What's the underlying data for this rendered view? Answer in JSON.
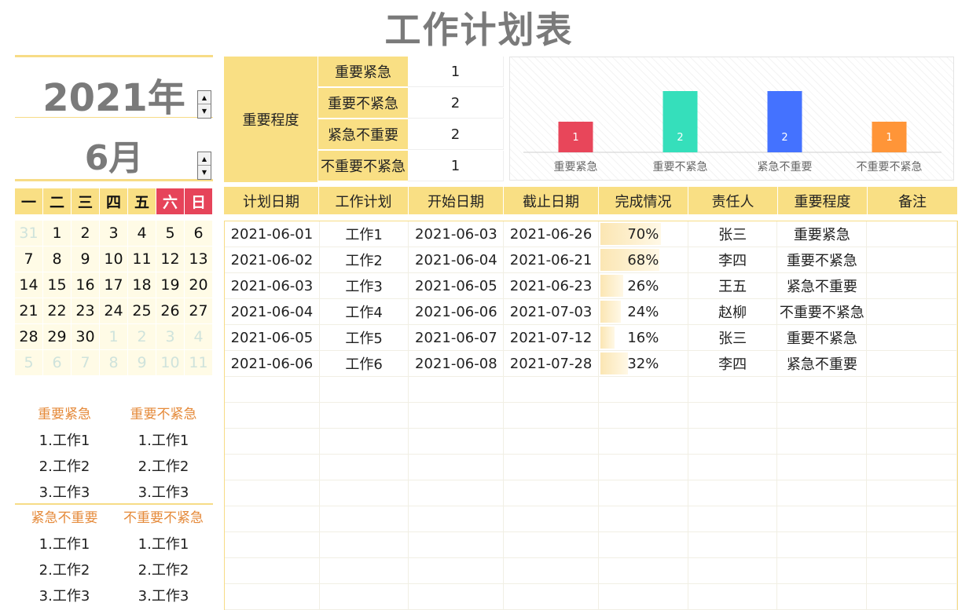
{
  "title": "工作计划表",
  "year": "2021年",
  "month": "6月",
  "calendar": {
    "weekdays": [
      "一",
      "二",
      "三",
      "四",
      "五",
      "六",
      "日"
    ],
    "weeks": [
      [
        {
          "d": "31",
          "dim": true
        },
        {
          "d": "1"
        },
        {
          "d": "2"
        },
        {
          "d": "3"
        },
        {
          "d": "4"
        },
        {
          "d": "5"
        },
        {
          "d": "6"
        }
      ],
      [
        {
          "d": "7"
        },
        {
          "d": "8"
        },
        {
          "d": "9"
        },
        {
          "d": "10"
        },
        {
          "d": "11"
        },
        {
          "d": "12"
        },
        {
          "d": "13"
        }
      ],
      [
        {
          "d": "14"
        },
        {
          "d": "15"
        },
        {
          "d": "16"
        },
        {
          "d": "17"
        },
        {
          "d": "18"
        },
        {
          "d": "19"
        },
        {
          "d": "20"
        }
      ],
      [
        {
          "d": "21"
        },
        {
          "d": "22"
        },
        {
          "d": "23"
        },
        {
          "d": "24"
        },
        {
          "d": "25"
        },
        {
          "d": "26"
        },
        {
          "d": "27"
        }
      ],
      [
        {
          "d": "28"
        },
        {
          "d": "29"
        },
        {
          "d": "30"
        },
        {
          "d": "1",
          "dim": true
        },
        {
          "d": "2",
          "dim": true
        },
        {
          "d": "3",
          "dim": true
        },
        {
          "d": "4",
          "dim": true
        }
      ],
      [
        {
          "d": "5",
          "dim": true
        },
        {
          "d": "6",
          "dim": true
        },
        {
          "d": "7",
          "dim": true
        },
        {
          "d": "8",
          "dim": true
        },
        {
          "d": "9",
          "dim": true
        },
        {
          "d": "10",
          "dim": true
        },
        {
          "d": "11",
          "dim": true
        }
      ]
    ]
  },
  "quadrants_top": {
    "left": {
      "title": "重要紧急",
      "items": [
        "1.工作1",
        "2.工作2",
        "3.工作3"
      ]
    },
    "right": {
      "title": "重要不紧急",
      "items": [
        "1.工作1",
        "2.工作2",
        "3.工作3"
      ]
    }
  },
  "quadrants_bottom": {
    "left": {
      "title": "紧急不重要",
      "items": [
        "1.工作1",
        "2.工作2",
        "3.工作3"
      ]
    },
    "right": {
      "title": "不重要不紧急",
      "items": [
        "1.工作1",
        "2.工作2",
        "3.工作3"
      ]
    }
  },
  "importance": {
    "label": "重要程度",
    "rows": [
      {
        "name": "重要紧急",
        "count": "1"
      },
      {
        "name": "重要不紧急",
        "count": "2"
      },
      {
        "name": "紧急不重要",
        "count": "2"
      },
      {
        "name": "不重要不紧急",
        "count": "1"
      }
    ]
  },
  "chart_data": {
    "type": "bar",
    "categories": [
      "重要紧急",
      "重要不紧急",
      "紧急不重要",
      "不重要不紧急"
    ],
    "values": [
      1,
      2,
      2,
      1
    ],
    "colors": [
      "#e8465a",
      "#35dfbb",
      "#4472ff",
      "#ff9538"
    ],
    "ylim": [
      0,
      2
    ],
    "grid": false,
    "data_labels": true
  },
  "table": {
    "headers": [
      "计划日期",
      "工作计划",
      "开始日期",
      "截止日期",
      "完成情况",
      "责任人",
      "重要程度",
      "备注"
    ],
    "rows": [
      {
        "plan_date": "2021-06-01",
        "task": "工作1",
        "start": "2021-06-03",
        "end": "2021-06-26",
        "progress": 70,
        "progress_label": "70%",
        "owner": "张三",
        "priority": "重要紧急",
        "note": ""
      },
      {
        "plan_date": "2021-06-02",
        "task": "工作2",
        "start": "2021-06-04",
        "end": "2021-06-21",
        "progress": 68,
        "progress_label": "68%",
        "owner": "李四",
        "priority": "重要不紧急",
        "note": ""
      },
      {
        "plan_date": "2021-06-03",
        "task": "工作3",
        "start": "2021-06-05",
        "end": "2021-06-23",
        "progress": 26,
        "progress_label": "26%",
        "owner": "王五",
        "priority": "紧急不重要",
        "note": ""
      },
      {
        "plan_date": "2021-06-04",
        "task": "工作4",
        "start": "2021-06-06",
        "end": "2021-07-03",
        "progress": 24,
        "progress_label": "24%",
        "owner": "赵柳",
        "priority": "不重要不紧急",
        "note": ""
      },
      {
        "plan_date": "2021-06-05",
        "task": "工作5",
        "start": "2021-06-07",
        "end": "2021-07-12",
        "progress": 16,
        "progress_label": "16%",
        "owner": "张三",
        "priority": "重要不紧急",
        "note": ""
      },
      {
        "plan_date": "2021-06-06",
        "task": "工作6",
        "start": "2021-06-08",
        "end": "2021-07-28",
        "progress": 32,
        "progress_label": "32%",
        "owner": "李四",
        "priority": "紧急不重要",
        "note": ""
      }
    ]
  }
}
